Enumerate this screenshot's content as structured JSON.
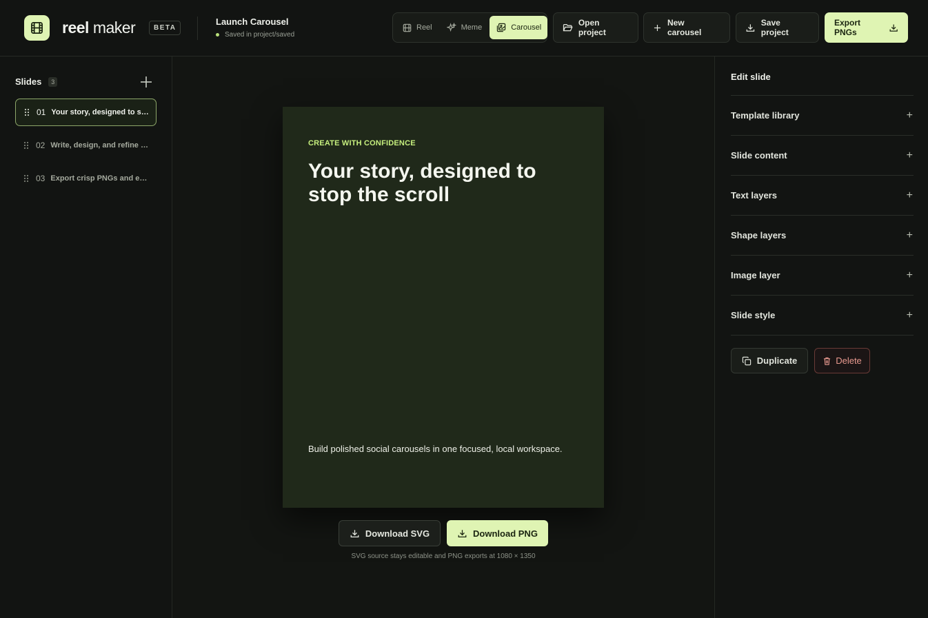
{
  "brand": {
    "name_bold": "reel",
    "name_rest": "maker",
    "badge": "BETA"
  },
  "project": {
    "title": "Launch Carousel",
    "status": "Saved in project/saved"
  },
  "modes": [
    {
      "label": "Reel",
      "icon": "film-icon"
    },
    {
      "label": "Meme",
      "icon": "sparkle-icon"
    },
    {
      "label": "Carousel",
      "icon": "images-icon",
      "active": true
    }
  ],
  "toolbar": {
    "open_label": "Open project",
    "new_label": "New carousel",
    "save_label": "Save project",
    "export_label": "Export PNGs"
  },
  "sidebar": {
    "title": "Slides",
    "count": "3",
    "items": [
      {
        "num": "01",
        "title": "Your story, designed to s…",
        "active": true
      },
      {
        "num": "02",
        "title": "Write, design, and refine …"
      },
      {
        "num": "03",
        "title": "Export crisp PNGs and e…"
      }
    ]
  },
  "slide": {
    "eyebrow": "CREATE WITH CONFIDENCE",
    "headline": "Your story, designed to stop the scroll",
    "body": "Build polished social carousels in one focused, local workspace."
  },
  "canvas": {
    "download_svg": "Download SVG",
    "download_png": "Download PNG",
    "note": "SVG source stays editable and PNG exports at 1080 × 1350"
  },
  "panel": {
    "title": "Edit slide",
    "sections": [
      "Template library",
      "Slide content",
      "Text layers",
      "Shape layers",
      "Image layer",
      "Slide style"
    ],
    "plus": "+",
    "duplicate": "Duplicate",
    "delete": "Delete"
  },
  "colors": {
    "accent": "#dff4b3",
    "slide_bg": "#20291a",
    "eyebrow": "#c6ef7e",
    "danger": "#e99a90"
  }
}
